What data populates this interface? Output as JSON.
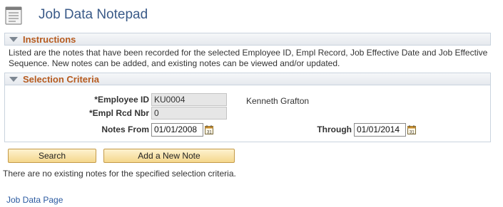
{
  "page": {
    "title": "Job Data Notepad"
  },
  "instructions": {
    "header": "Instructions",
    "text": "Listed are the notes that have been recorded for the selected Employee ID, Empl Record, Job Effective Date and Job Effective Sequence. New notes can be added, and existing notes can be viewed and/or updated."
  },
  "selection": {
    "header": "Selection Criteria",
    "employee_id_label": "*Employee ID",
    "employee_id_value": "KU0004",
    "employee_name": "Kenneth Grafton",
    "empl_rcd_label": "*Empl Rcd Nbr",
    "empl_rcd_value": "0",
    "notes_from_label": "Notes From",
    "notes_from_value": "01/01/2008",
    "through_label": "Through",
    "through_value": "01/01/2014"
  },
  "buttons": {
    "search": "Search",
    "add_note": "Add a New Note"
  },
  "message": "There are no existing notes for the specified selection criteria.",
  "links": {
    "job_data_page": "Job Data Page"
  },
  "colors": {
    "title": "#3a5a88",
    "section_label": "#b65b1f",
    "link": "#2b5aa0",
    "button": "#f5d78d"
  }
}
